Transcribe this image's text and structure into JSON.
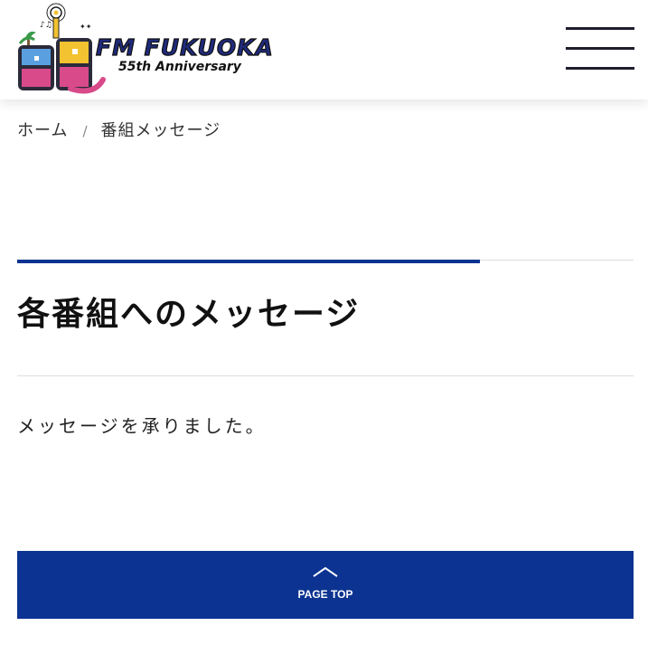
{
  "header": {
    "logo": {
      "wordmark": "FM FUKUOKA",
      "anniversary": "55th Anniversary"
    },
    "menu_icon": "hamburger-icon"
  },
  "breadcrumb": {
    "home": "ホーム",
    "separator": "/",
    "current": "番組メッセージ"
  },
  "main": {
    "title": "各番組へのメッセージ",
    "message": "メッセージを承りました。"
  },
  "page_top": {
    "icon": "chevron-up-icon",
    "label": "PAGE TOP"
  },
  "colors": {
    "brand_blue": "#0c3391",
    "rule_gray": "#dddddd",
    "text": "#222222"
  }
}
